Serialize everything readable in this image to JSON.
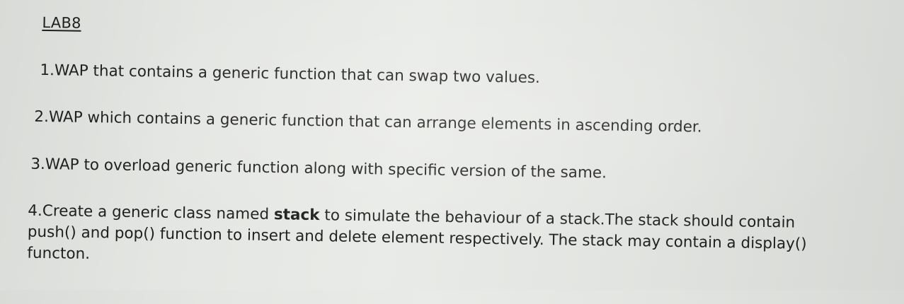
{
  "document": {
    "title": "LAB8",
    "questions": [
      {
        "text": "1.WAP that contains a generic function that can swap two values."
      },
      {
        "text": "2.WAP which contains a generic function that can arrange elements in ascending order."
      },
      {
        "text": "3.WAP to overload generic function along with specific version of the same."
      },
      {
        "line1_prefix": "4.Create a generic class named ",
        "line1_bold": "stack",
        "line1_suffix": " to simulate the behaviour of a stack.The stack should contain",
        "line2": "push() and pop() function to insert and delete element respectively. The stack may contain a display()",
        "line3": "functon."
      }
    ]
  }
}
